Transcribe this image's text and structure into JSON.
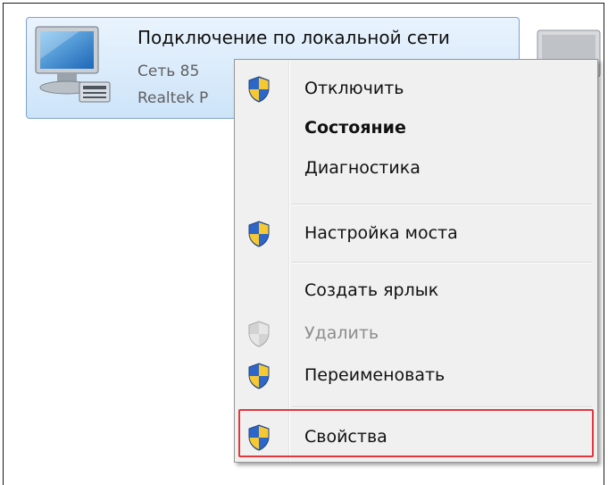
{
  "connection": {
    "title": "Подключение по локальной сети",
    "network": "Сеть 85",
    "adapter": "Realtek P"
  },
  "menu": {
    "items": [
      {
        "label": "Отключить"
      },
      {
        "label": "Состояние"
      },
      {
        "label": "Диагностика"
      },
      {
        "label": "Настройка моста"
      },
      {
        "label": "Создать ярлык"
      },
      {
        "label": "Удалить"
      },
      {
        "label": "Переименовать"
      },
      {
        "label": "Свойства"
      }
    ]
  },
  "colors": {
    "highlight_border": "#e0383d",
    "tile_selected": "#cde4f9"
  }
}
